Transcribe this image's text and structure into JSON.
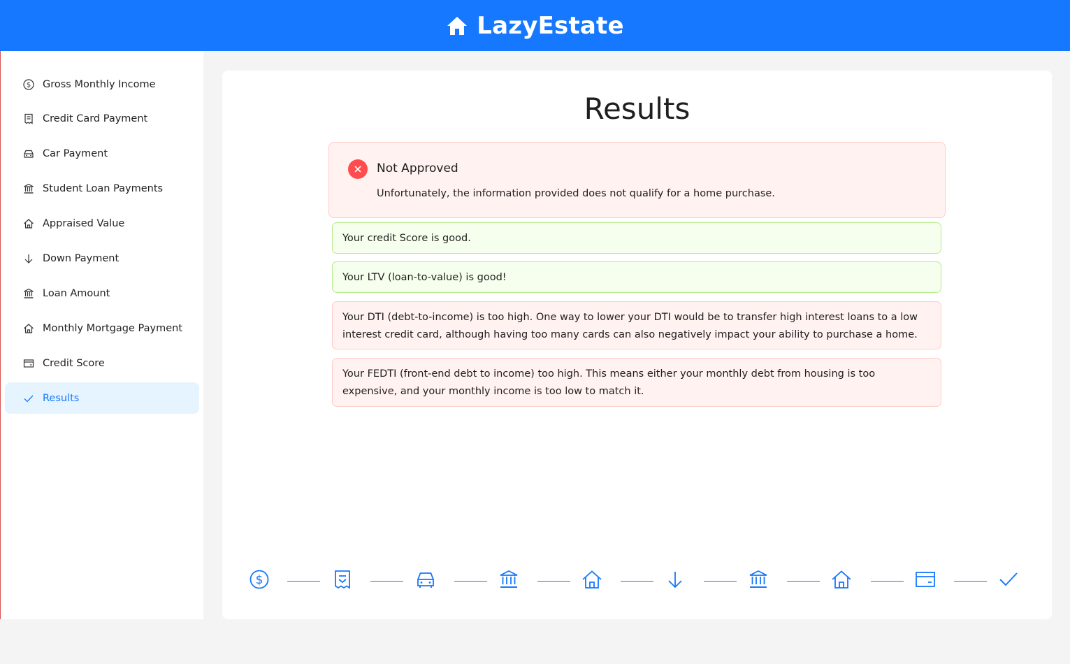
{
  "app": {
    "title": "LazyEstate",
    "brand_color": "#1677ff"
  },
  "sidebar": {
    "items": [
      {
        "label": "Gross Monthly Income",
        "icon": "dollar-circle-icon"
      },
      {
        "label": "Credit Card Payment",
        "icon": "receipt-icon"
      },
      {
        "label": "Car Payment",
        "icon": "car-icon"
      },
      {
        "label": "Student Loan Payments",
        "icon": "bank-icon"
      },
      {
        "label": "Appraised Value",
        "icon": "home-icon"
      },
      {
        "label": "Down Payment",
        "icon": "arrow-down-icon"
      },
      {
        "label": "Loan Amount",
        "icon": "bank-icon"
      },
      {
        "label": "Monthly Mortgage Payment",
        "icon": "home-icon"
      },
      {
        "label": "Credit Score",
        "icon": "credit-card-icon"
      },
      {
        "label": "Results",
        "icon": "check-icon",
        "active": true
      }
    ]
  },
  "main": {
    "title": "Results",
    "alert": {
      "title": "Not Approved",
      "description": "Unfortunately, the information provided does not qualify for a home purchase.",
      "status_color": "#ff4d4f"
    },
    "messages": [
      {
        "status": "good",
        "text": "Your credit Score is good."
      },
      {
        "status": "good",
        "text": "Your LTV (loan-to-value) is good!"
      },
      {
        "status": "bad",
        "text": "Your DTI (debt-to-income) is too high. One way to lower your DTI would be to transfer high interest loans to a low interest credit card, although having too many cards can also negatively impact your ability to purchase a home."
      },
      {
        "status": "bad",
        "text": "Your FEDTI (front-end debt to income) too high. This means either your monthly debt from housing is too expensive, and your monthly income is too low to match it."
      }
    ],
    "steps": [
      {
        "icon": "dollar-circle-icon"
      },
      {
        "icon": "receipt-icon"
      },
      {
        "icon": "car-icon"
      },
      {
        "icon": "bank-icon"
      },
      {
        "icon": "home-icon"
      },
      {
        "icon": "arrow-down-icon"
      },
      {
        "icon": "bank-icon"
      },
      {
        "icon": "home-icon"
      },
      {
        "icon": "credit-card-icon"
      },
      {
        "icon": "check-icon"
      }
    ]
  }
}
